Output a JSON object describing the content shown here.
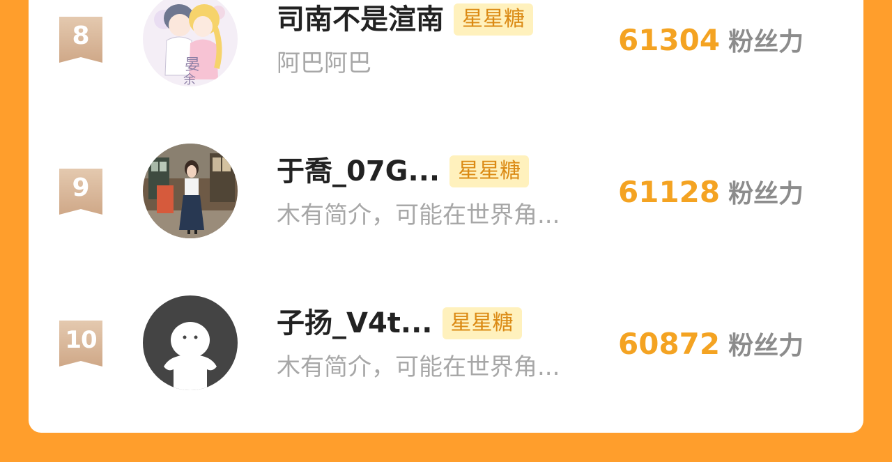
{
  "ranking": [
    {
      "rank": "8",
      "name": "司南不是渲南",
      "tag": "星星糖",
      "bio": "阿巴阿巴",
      "score": "61304",
      "score_unit": "粉丝力",
      "avatar_icon": "anime-couple-avatar"
    },
    {
      "rank": "9",
      "name": "于喬_07G...",
      "tag": "星星糖",
      "bio": "木有简介，可能在世界角...",
      "score": "61128",
      "score_unit": "粉丝力",
      "avatar_icon": "photo-girl-avatar"
    },
    {
      "rank": "10",
      "name": "子扬_V4t...",
      "tag": "星星糖",
      "bio": "木有简介，可能在世界角...",
      "score": "60872",
      "score_unit": "粉丝力",
      "avatar_icon": "default-user-avatar"
    }
  ],
  "colors": {
    "background": "#FF9E2C",
    "score": "#F4A322",
    "tag_bg": "#FFF1BD",
    "tag_text": "#DB8A14",
    "rank_badge": "#D6B08E"
  }
}
